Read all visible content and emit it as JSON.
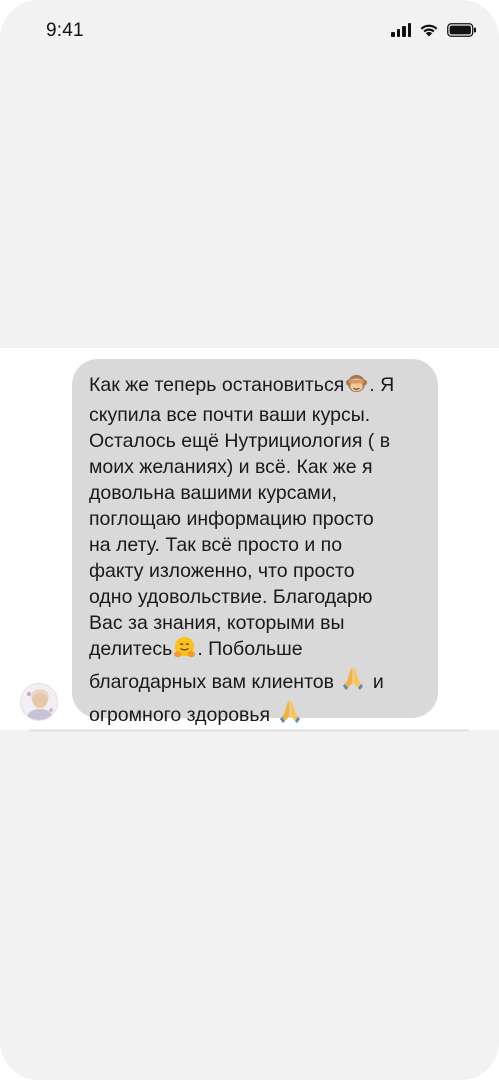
{
  "status_bar": {
    "time": "9:41",
    "icons": [
      "signal-icon",
      "wifi-icon",
      "battery-icon"
    ]
  },
  "conversation": {
    "sender_avatar": "avatar",
    "message": {
      "lines": [
        "Как же теперь остановиться",
        ". Я",
        "скупила все почти ваши курсы.",
        "Осталось ещё Нутрициология ( в",
        "моих желаниях) и всё.  Как же я",
        "довольна вашими курсами,",
        "поглощаю информацию просто",
        "на лету. Так всё просто и по",
        "факту изложенно, что просто",
        "одно удовольствие. Благодарю",
        "Вас за знания, которыми вы",
        "делитесь",
        ". Побольше",
        "благодарных вам клиентов",
        "и",
        "огромного здоровья"
      ],
      "emojis": [
        "see-no-evil-monkey-emoji",
        "hugging-face-emoji",
        "folded-hands-emoji",
        "folded-hands-emoji"
      ]
    }
  },
  "colors": {
    "screen_background": "#f2f2f2",
    "message_band": "#ffffff",
    "bubble": "#d9d9d9",
    "text": "#1a1a1a"
  }
}
